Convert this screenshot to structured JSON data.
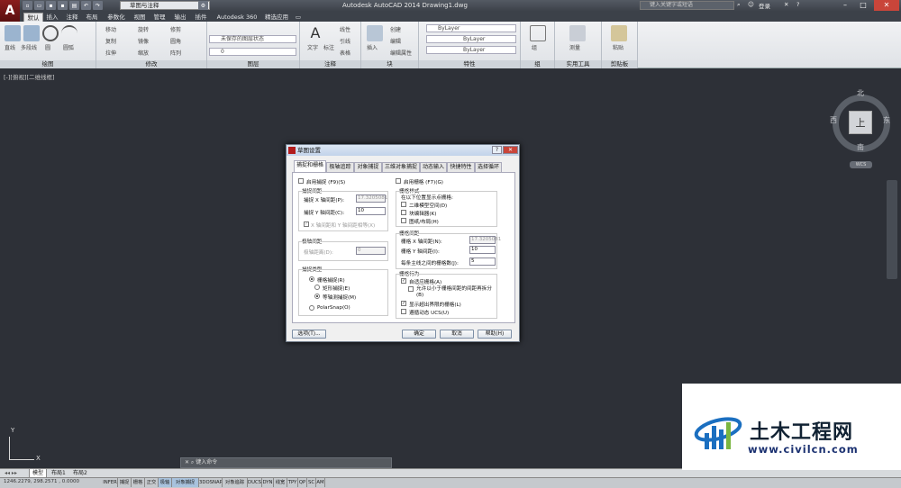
{
  "titlebar": {
    "logo": "A",
    "workspace": "草图与注释",
    "app_title": "Autodesk AutoCAD 2014    Drawing1.dwg",
    "search_placeholder": "键入关键字或短语",
    "login": "登录"
  },
  "tabs": [
    "默认",
    "插入",
    "注释",
    "布局",
    "参数化",
    "视图",
    "管理",
    "输出",
    "插件",
    "Autodesk 360",
    "精选应用"
  ],
  "ribbon": {
    "panels": [
      "绘图",
      "修改",
      "图层",
      "注释",
      "块",
      "特性",
      "组",
      "实用工具",
      "剪贴板"
    ],
    "draw_tools": [
      "直线",
      "多段线",
      "圆",
      "圆弧"
    ],
    "modify_tools": [
      "移动",
      "旋转",
      "修剪",
      "复制",
      "镜像",
      "圆角",
      "拉伸",
      "缩放",
      "阵列"
    ],
    "layer_state": "未保存的图层状态",
    "layer_current": "0",
    "annotation_tools": [
      "文字",
      "标注",
      "线性",
      "引线",
      "表格"
    ],
    "block_tools": [
      "插入",
      "创建",
      "编辑",
      "编辑属性"
    ],
    "bylayer": [
      "ByLayer",
      "ByLayer",
      "ByLayer"
    ],
    "extra_tools": [
      "组",
      "测量",
      "粘贴"
    ]
  },
  "viewport": {
    "label": "[-][俯视][二维线框]"
  },
  "viewcube": {
    "top": "上",
    "north": "北",
    "south": "南",
    "east": "东",
    "west": "西",
    "wcs": "WCS"
  },
  "ucs": {
    "x": "X",
    "y": "Y"
  },
  "commandline": {
    "placeholder": "键入命令"
  },
  "layout_tabs": [
    "模型",
    "布局1",
    "布局2"
  ],
  "statusbar": {
    "coords": "1246.2279, 298.2571 , 0.0000",
    "buttons": [
      "INFER",
      "捕捉",
      "栅格",
      "正交",
      "极轴",
      "对象捕捉",
      "3DOSNAP",
      "对象追踪",
      "DUCS",
      "DYN",
      "线宽",
      "TPY",
      "QP",
      "SC",
      "AM"
    ],
    "on_index": [
      4,
      5
    ]
  },
  "dialog": {
    "title": "草图设置",
    "tabs": [
      "捕捉和栅格",
      "极轴追踪",
      "对象捕捉",
      "三维对象捕捉",
      "动态输入",
      "快捷特性",
      "选择循环"
    ],
    "snap_on": "启用捕捉 (F9)(S)",
    "snap_spacing_title": "捕捉间距",
    "snap_x_label": "捕捉 X 轴间距(P):",
    "snap_x_value": "17.3205081",
    "snap_y_label": "捕捉 Y 轴间距(C):",
    "snap_y_value": "10",
    "equal_xy": "X 轴间距和 Y 轴间距相等(X)",
    "polar_spacing_title": "极轴间距",
    "polar_distance_label": "极轴距离(D):",
    "polar_distance_value": "0",
    "snap_type_title": "捕捉类型",
    "grid_snap": "栅格捕捉(R)",
    "rect_snap": "矩形捕捉(E)",
    "iso_snap": "等轴测捕捉(M)",
    "polar_snap": "PolarSnap(O)",
    "grid_on": "启用栅格 (F7)(G)",
    "grid_style_title": "栅格样式",
    "grid_style_desc": "在以下位置显示点栅格:",
    "style_2d": "二维模型空间(D)",
    "style_block": "块编辑器(K)",
    "style_sheet": "图纸/布局(H)",
    "grid_spacing_title": "栅格间距",
    "grid_x_label": "栅格 X 轴间距(N):",
    "grid_x_value": "17.3205081",
    "grid_y_label": "栅格 Y 轴间距(I):",
    "grid_y_value": "10",
    "major_label": "每条主线之间的栅格数(J):",
    "major_value": "5",
    "grid_behavior_title": "栅格行为",
    "adaptive": "自适应栅格(A)",
    "subdivide": "允许以小于栅格间距的间距再拆分(B)",
    "beyond_limits": "显示超出界限的栅格(L)",
    "follow_ucs": "遵循动态 UCS(U)",
    "options_btn": "选项(T)...",
    "ok_btn": "确定",
    "cancel_btn": "取消",
    "help_btn": "帮助(H)"
  },
  "watermark": {
    "name": "土木工程网",
    "url": "www.civilcn.com"
  }
}
